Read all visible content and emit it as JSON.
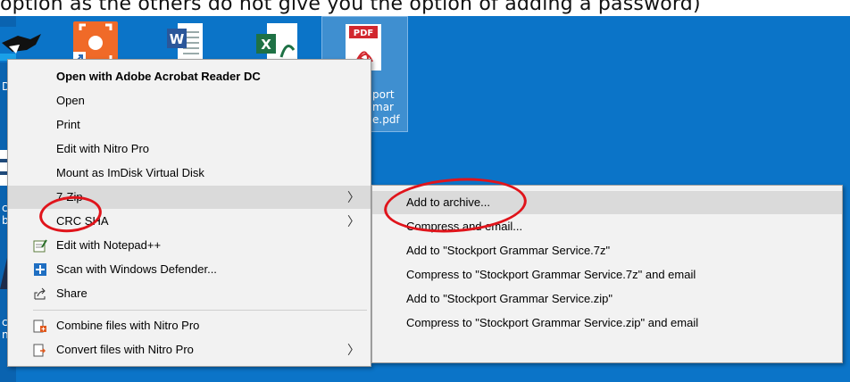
{
  "caption": "option as the others do not give you the option of adding a password)",
  "desktop": {
    "left_labels": [
      "Dr",
      "ce",
      "br",
      "ce",
      "ng"
    ],
    "pdf_label": [
      "port",
      "mar",
      "e.pdf"
    ],
    "pdf_badge": "PDF",
    "word_badge": "W",
    "excel_badge": "X"
  },
  "context_menu": {
    "items": [
      {
        "label": "Open with Adobe Acrobat Reader DC",
        "bold": true,
        "icon": "",
        "submenu": false
      },
      {
        "label": "Open",
        "bold": false,
        "icon": "",
        "submenu": false
      },
      {
        "label": "Print",
        "bold": false,
        "icon": "",
        "submenu": false
      },
      {
        "label": "Edit with Nitro Pro",
        "bold": false,
        "icon": "",
        "submenu": false
      },
      {
        "label": "Mount as ImDisk Virtual Disk",
        "bold": false,
        "icon": "",
        "submenu": false
      },
      {
        "label": "7-Zip",
        "bold": false,
        "icon": "",
        "submenu": true,
        "highlighted": true
      },
      {
        "label": "CRC SHA",
        "bold": false,
        "icon": "",
        "submenu": true
      },
      {
        "label": "Edit with Notepad++",
        "bold": false,
        "icon": "notepad-icon",
        "submenu": false
      },
      {
        "label": "Scan with Windows Defender...",
        "bold": false,
        "icon": "defender-icon",
        "submenu": false
      },
      {
        "label": "Share",
        "bold": false,
        "icon": "share-icon",
        "submenu": false
      },
      {
        "label": "Combine files with Nitro Pro",
        "bold": false,
        "icon": "nitro-combine-icon",
        "submenu": false
      },
      {
        "label": "Convert files with Nitro Pro",
        "bold": false,
        "icon": "nitro-convert-icon",
        "submenu": true
      }
    ],
    "submenu_arrow": "〉"
  },
  "zip_submenu": {
    "items": [
      {
        "label": "Add to archive...",
        "highlighted": true
      },
      {
        "label": "Compress and email..."
      },
      {
        "label": "Add to \"Stockport Grammar Service.7z\""
      },
      {
        "label": "Compress to \"Stockport Grammar Service.7z\" and email"
      },
      {
        "label": "Add to \"Stockport Grammar Service.zip\""
      },
      {
        "label": "Compress to \"Stockport Grammar Service.zip\" and email"
      }
    ]
  },
  "colors": {
    "desktop_bg": "#0b74c8",
    "menu_bg": "#f2f2f2",
    "highlight": "#dadada",
    "annotation_red": "#e0141b"
  }
}
